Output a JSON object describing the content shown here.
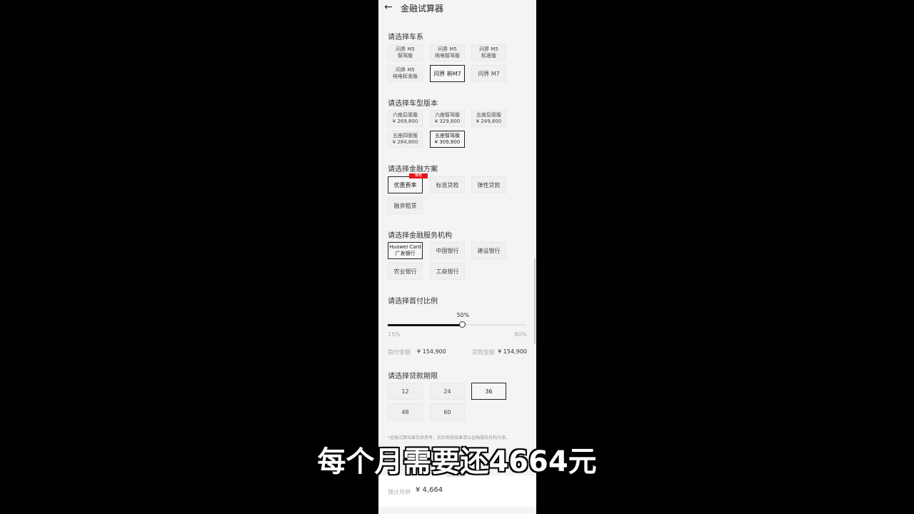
{
  "header": {
    "title": "金融试算器",
    "back_icon": "arrow-left-icon"
  },
  "series": {
    "label": "请选择车系",
    "options": [
      [
        "问界 M5",
        "智驾版"
      ],
      [
        "问界 M5",
        "纯电智驾版"
      ],
      [
        "问界 M5",
        "标准版"
      ],
      [
        "问界 M5",
        "纯电标准版"
      ],
      [
        "问界 新M7",
        ""
      ],
      [
        "问界 M7",
        ""
      ]
    ],
    "selected": 4
  },
  "version": {
    "label": "请选择车型版本",
    "options": [
      [
        "六座后驱版",
        "¥ 269,800"
      ],
      [
        "六座智驾版",
        "¥ 329,800"
      ],
      [
        "五座后驱版",
        "¥ 249,800"
      ],
      [
        "五座四驱版",
        "¥ 284,800"
      ],
      [
        "五座智驾版",
        "¥ 309,800"
      ]
    ],
    "selected": 4
  },
  "plan": {
    "label": "请选择金融方案",
    "options": [
      "优惠费率",
      "标准贷款",
      "弹性贷款",
      "融资租赁"
    ],
    "selected": 0,
    "badge": "推荐",
    "badge_color": "#e5161b"
  },
  "institution": {
    "label": "请选择金融服务机构",
    "options": [
      [
        "Huawei Card",
        "广发银行"
      ],
      [
        "中国银行",
        ""
      ],
      [
        "建设银行",
        ""
      ],
      [
        "农业银行",
        ""
      ],
      [
        "工商银行",
        ""
      ]
    ],
    "selected": 0
  },
  "downpayment": {
    "label": "请选择首付比例",
    "value": "50%",
    "value_percent": 50,
    "min": "15%",
    "max": "80%",
    "min_percent": 15,
    "max_percent": 80,
    "down_label": "首付金额",
    "down_value": "¥ 154,900",
    "loan_label": "贷款金额",
    "loan_value": "¥ 154,900"
  },
  "term": {
    "label": "请选择贷款期限",
    "options": [
      "12",
      "24",
      "36",
      "48",
      "60"
    ],
    "selected": 2
  },
  "disclaimer": "*金融试算结果仅供参考，实际审批结果请以金融服务机构为准。",
  "footer": {
    "label": "预计月供",
    "value": "¥ 4,664"
  },
  "subtitle": "每个月需要还4664元"
}
